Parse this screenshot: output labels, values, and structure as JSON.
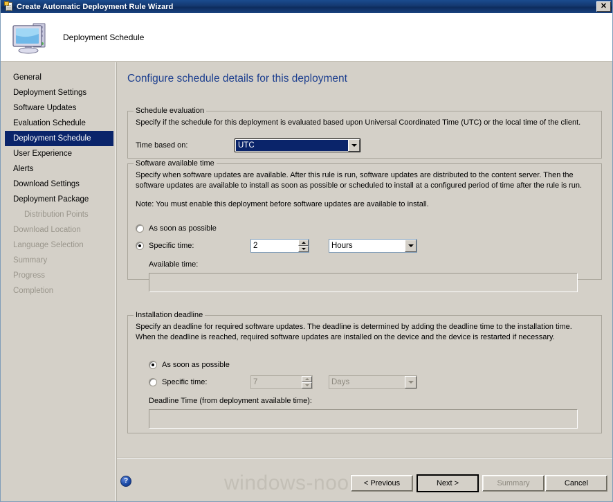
{
  "window": {
    "title": "Create Automatic Deployment Rule Wizard",
    "title_icon": "wizard-clipboard-icon",
    "close_label": "✕"
  },
  "header": {
    "icon": "computer-monitor-icon",
    "title": "Deployment Schedule"
  },
  "sidebar": {
    "items": [
      {
        "label": "General",
        "state": "enabled",
        "sub": false
      },
      {
        "label": "Deployment Settings",
        "state": "enabled",
        "sub": false
      },
      {
        "label": "Software Updates",
        "state": "enabled",
        "sub": false
      },
      {
        "label": "Evaluation Schedule",
        "state": "enabled",
        "sub": false
      },
      {
        "label": "Deployment Schedule",
        "state": "selected",
        "sub": false
      },
      {
        "label": "User Experience",
        "state": "enabled",
        "sub": false
      },
      {
        "label": "Alerts",
        "state": "enabled",
        "sub": false
      },
      {
        "label": "Download Settings",
        "state": "enabled",
        "sub": false
      },
      {
        "label": "Deployment Package",
        "state": "enabled",
        "sub": false
      },
      {
        "label": "Distribution Points",
        "state": "disabled",
        "sub": true
      },
      {
        "label": "Download Location",
        "state": "disabled",
        "sub": false
      },
      {
        "label": "Language Selection",
        "state": "disabled",
        "sub": false
      },
      {
        "label": "Summary",
        "state": "disabled",
        "sub": false
      },
      {
        "label": "Progress",
        "state": "disabled",
        "sub": false
      },
      {
        "label": "Completion",
        "state": "disabled",
        "sub": false
      }
    ]
  },
  "main": {
    "page_heading": "Configure schedule details for this deployment",
    "schedule_evaluation": {
      "title": "Schedule evaluation",
      "description": "Specify if the schedule for this deployment is evaluated based upon Universal Coordinated Time (UTC) or the local time of the client.",
      "time_based_on_label": "Time based on:",
      "time_based_on_value": "UTC"
    },
    "software_available_time": {
      "title": "Software available time",
      "description": "Specify when software updates are available. After this rule is run, software updates are distributed to the content server. Then the software updates are available to install as soon as possible or scheduled to install at a configured period of time after the rule is run.",
      "note": "Note: You must enable this deployment before software updates are available to install.",
      "asap_label": "As soon as possible",
      "asap_selected": false,
      "specific_label": "Specific time:",
      "specific_selected": true,
      "amount_value": "2",
      "unit_value": "Hours",
      "available_time_label": "Available time:",
      "available_time_value": ""
    },
    "installation_deadline": {
      "title": "Installation deadline",
      "description": "Specify an deadline for required software updates. The deadline is determined by adding the deadline time to the installation time. When the deadline is reached, required software updates are installed on the device and the device is restarted if necessary.",
      "asap_label": "As soon as possible",
      "asap_selected": true,
      "specific_label": "Specific time:",
      "specific_selected": false,
      "amount_value": "7",
      "unit_value": "Days",
      "deadline_time_label": "Deadline Time (from deployment available time):",
      "deadline_time_value": ""
    }
  },
  "footer": {
    "help_icon": "help-question-icon",
    "help_glyph": "?",
    "watermark": "windows-noob.com",
    "previous_label": "< Previous",
    "next_label": "Next >",
    "summary_label": "Summary",
    "cancel_label": "Cancel"
  },
  "colors": {
    "titlebar": "#14386f",
    "dialog_face": "#d4d0c8",
    "heading_blue": "#1d3f8f",
    "selection_blue": "#0a246a",
    "disabled_text": "#8d897f"
  }
}
